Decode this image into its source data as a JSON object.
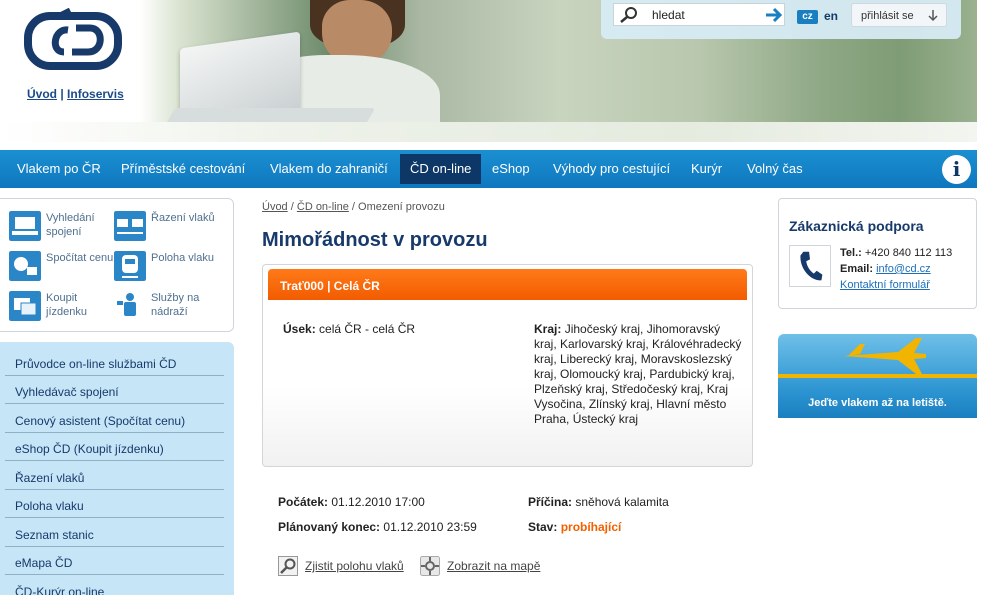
{
  "header": {
    "links": [
      "Úvod",
      "Infoservis"
    ],
    "search": {
      "value": "hledat"
    },
    "lang_active": "cz",
    "lang_other": "en",
    "login_label": "přihlásit se"
  },
  "nav": {
    "items": [
      {
        "label": "Vlakem po ČR"
      },
      {
        "label": "Příměstské cestování"
      },
      {
        "label": "Vlakem do zahraničí"
      },
      {
        "label": "ČD on-line"
      },
      {
        "label": "eShop"
      },
      {
        "label": "Výhody pro cestující"
      },
      {
        "label": "Kurýr"
      },
      {
        "label": "Volný čas"
      }
    ],
    "active": "ČD on-line"
  },
  "quick_links": [
    {
      "label": "Vyhledání spojení",
      "icon": "laptop-icon"
    },
    {
      "label": "Řazení vlaků",
      "icon": "train-composition-icon"
    },
    {
      "label": "Spočítat cenu",
      "icon": "euro-price-icon"
    },
    {
      "label": "Poloha vlaku",
      "icon": "train-position-icon"
    },
    {
      "label": "Koupit jízdenku",
      "icon": "ticket-icon"
    },
    {
      "label": "Služby na nádraží",
      "icon": "station-staff-icon"
    }
  ],
  "sidenav": [
    "Průvodce on-line službami ČD",
    "Vyhledávač spojení",
    "Cenový asistent (Spočítat cenu)",
    "eShop ČD (Koupit jízdenku)",
    "Řazení vlaků",
    "Poloha vlaku",
    "Seznam stanic",
    "eMapa ČD",
    "ČD-Kurýr on-line"
  ],
  "breadcrumb": [
    "Úvod",
    "ČD on-line",
    "Omezení provozu"
  ],
  "page_title": "Mimořádnost v provozu",
  "event": {
    "heading": "Trať000 | Celá ČR",
    "usek_label": "Úsek:",
    "usek_value": "celá ČR - celá ČR",
    "kraj_label": "Kraj:",
    "kraj_value": "Jihočeský kraj, Jihomoravský kraj, Karlovarský kraj, Královéhradecký kraj, Liberecký kraj, Moravskoslezský kraj, Olomoucký kraj, Pardubický kraj, Plzeňský kraj, Středočeský kraj, Kraj Vysočina, Zlínský kraj, Hlavní město Praha, Ústecký kraj"
  },
  "details": {
    "start_label": "Počátek:",
    "start_value": "01.12.2010 17:00",
    "end_label": "Plánovaný konec:",
    "end_value": "01.12.2010 23:59",
    "cause_label": "Příčina:",
    "cause_value": "sněhová kalamita",
    "status_label": "Stav:",
    "status_value": "probíhající"
  },
  "actions": [
    {
      "label": "Zjistit polohu vlaků",
      "icon": "magnifier-icon"
    },
    {
      "label": "Zobrazit na mapě",
      "icon": "map-target-icon"
    }
  ],
  "support": {
    "title": "Zákaznická podpora",
    "tel_label": "Tel.:",
    "tel_value": "+420 840 112 113",
    "email_label": "Email:",
    "email_value": "info@cd.cz",
    "form_link": "Kontaktní formulář"
  },
  "banner": {
    "text": "Jeďte vlakem až na letiště."
  },
  "colors": {
    "nav_blue": "#1b8fd2",
    "nav_active": "#0d3766",
    "heading_blue": "#173a6b",
    "orange": "#f26000",
    "sidenav_bg": "#c6e5f7"
  }
}
